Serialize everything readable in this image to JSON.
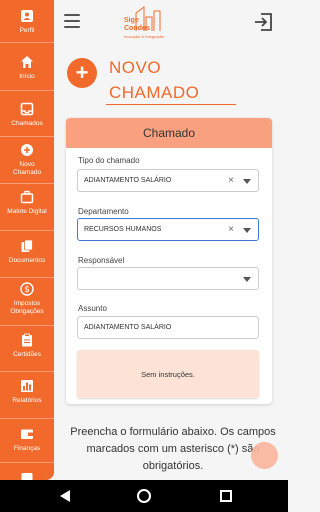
{
  "sidebar": {
    "items": [
      {
        "label": "Perfil",
        "icon": "user-icon"
      },
      {
        "label": "Início",
        "icon": "home-icon"
      },
      {
        "label": "Chamados",
        "icon": "inbox-icon"
      },
      {
        "label": "Novo Chamado",
        "icon": "add-circle-icon"
      },
      {
        "label": "Malote Digital",
        "icon": "briefcase-icon"
      },
      {
        "label": "Documentos",
        "icon": "documents-icon"
      },
      {
        "label": "Impostos Obrigações",
        "icon": "dollar-icon"
      },
      {
        "label": "Certidões",
        "icon": "clipboard-icon"
      },
      {
        "label": "Relatórios",
        "icon": "bar-chart-icon"
      },
      {
        "label": "Finanças",
        "icon": "wallet-icon"
      }
    ]
  },
  "header": {
    "logo_line1": "Sige",
    "logo_line2": "Condos",
    "logo_tagline": "Inovação & Integração"
  },
  "page": {
    "title_line1": "NOVO",
    "title_line2": "CHAMADO"
  },
  "form": {
    "card_title": "Chamado",
    "tipo_label": "Tipo do chamado",
    "tipo_value": "ADIANTAMENTO SALÁRIO",
    "departamento_label": "Departamento",
    "departamento_value": "RECURSOS HUMANOS",
    "responsavel_label": "Responsável",
    "responsavel_value": "",
    "assunto_label": "Assunto",
    "assunto_value": "ADIANTAMENTO SALÁRIO",
    "instructions": "Sem instruções."
  },
  "footer": {
    "text": "Preencha o formulário abaixo. Os campos marcados com um asterisco (*) são obrigatórios."
  },
  "colors": {
    "brand": "#f26a2b",
    "card_header": "#f9a17f",
    "instructions_bg": "#fde3d6",
    "focus": "#3b7bd6"
  }
}
